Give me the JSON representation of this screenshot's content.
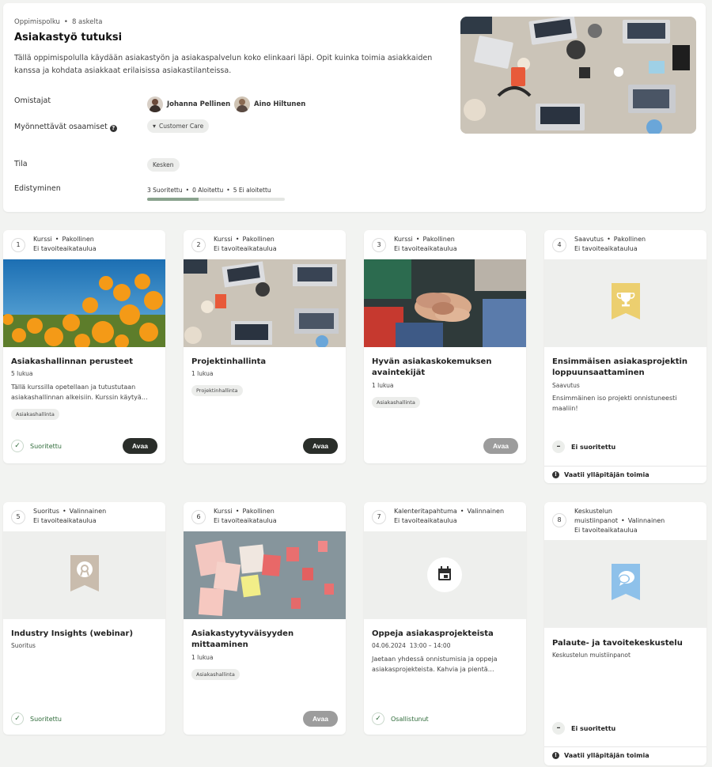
{
  "header": {
    "breadcrumb_type": "Oppimispolku",
    "breadcrumb_steps": "8 askelta",
    "title": "Asiakastyö tutuksi",
    "description": "Tällä oppimispolulla käydään asiakastyön ja asiakaspalvelun koko elinkaari läpi. Opit kuinka toimia asiakkaiden kanssa ja kohdata asiakkaat erilaisissa asiakastilanteissa.",
    "owners_label": "Omistajat",
    "owners": [
      "Johanna Pellinen",
      "Aino Hiltunen"
    ],
    "skills_label": "Myönnettävät osaamiset",
    "skill": "Customer Care",
    "state_label": "Tila",
    "state": "Kesken",
    "progress_label": "Edistyminen",
    "progress": {
      "completed": "3 Suoritettu",
      "started": "0 Aloitettu",
      "not_started": "5 Ei aloitettu",
      "fraction": 0.375
    },
    "image_icon": "office-desk-photo"
  },
  "cards": [
    {
      "num": "1",
      "type": "Kurssi",
      "req": "Pakollinen",
      "schedule": "Ei tavoiteaikataulua",
      "title": "Asiakashallinnan perusteet",
      "sub": "5 lukua",
      "desc": "Tällä kurssilla opetellaan ja tutustutaan asiakashallinnan alkeisiin. Kurssin käytyä…",
      "tag": "Asiakashallinta",
      "status": "Suoritettu",
      "button": "Avaa"
    },
    {
      "num": "2",
      "type": "Kurssi",
      "req": "Pakollinen",
      "schedule": "Ei tavoiteaikataulua",
      "title": "Projektinhallinta",
      "sub": "1 lukua",
      "tag": "Projektinhallinta",
      "button": "Avaa"
    },
    {
      "num": "3",
      "type": "Kurssi",
      "req": "Pakollinen",
      "schedule": "Ei tavoiteaikataulua",
      "title": "Hyvän asiakaskokemuksen avaintekijät",
      "sub": "1 lukua",
      "tag": "Asiakashallinta",
      "button": "Avaa"
    },
    {
      "num": "4",
      "type": "Saavutus",
      "req": "Pakollinen",
      "schedule": "Ei tavoiteaikataulua",
      "title": "Ensimmäisen asiakasprojektin loppuunsaattaminen",
      "sub": "Saavutus",
      "desc": "Ensimmäinen iso projekti onnistuneesti maaliin!",
      "status": "Ei suoritettu",
      "footer": "Vaatii ylläpitäjän toimia"
    },
    {
      "num": "5",
      "type": "Suoritus",
      "req": "Valinnainen",
      "schedule": "Ei tavoiteaikataulua",
      "title": "Industry Insights (webinar)",
      "sub": "Suoritus",
      "status": "Suoritettu"
    },
    {
      "num": "6",
      "type": "Kurssi",
      "req": "Pakollinen",
      "schedule": "Ei tavoiteaikataulua",
      "title": "Asiakastyytyväisyyden mittaaminen",
      "sub": "1 lukua",
      "tag": "Asiakashallinta",
      "button": "Avaa"
    },
    {
      "num": "7",
      "type": "Kalenteritapahtuma",
      "req": "Valinnainen",
      "schedule": "Ei tavoiteaikataulua",
      "title": "Oppeja asiakasprojekteista",
      "date": "04.06.2024",
      "time": "13:00 – 14:00",
      "desc": "Jaetaan yhdessä onnistumisia ja oppeja asiakasprojekteista. Kahvia ja pientä…",
      "status": "Osallistunut"
    },
    {
      "num": "8",
      "type_line1": "Keskustelun",
      "type_line2": "muistiinpanot",
      "req": "Valinnainen",
      "schedule": "Ei tavoiteaikataulua",
      "title": "Palaute- ja tavoitekeskustelu",
      "sub": "Keskustelun muistiinpanot",
      "status": "Ei suoritettu",
      "footer": "Vaatii ylläpitäjän toimia"
    }
  ],
  "colors": {
    "accent": "#2a2e2a",
    "success": "#2f6b3a",
    "progress": "#8aa38e",
    "ribbon_gold": "#eccf6f",
    "ribbon_beige": "#c9bcad",
    "ribbon_blue": "#8ec1ea"
  }
}
